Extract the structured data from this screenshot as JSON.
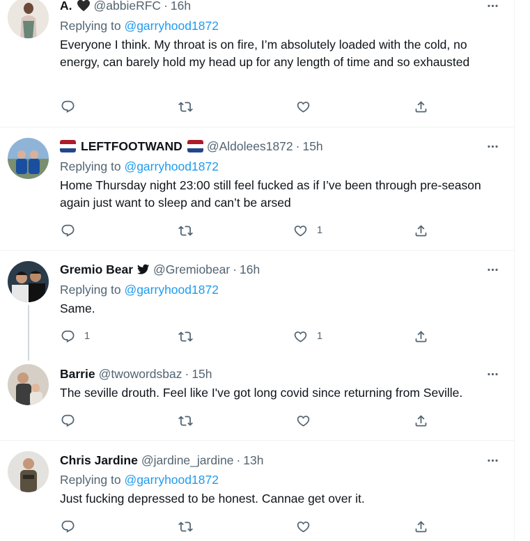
{
  "common": {
    "replying_prefix": "Replying to",
    "dot": "·"
  },
  "tweets": [
    {
      "display_name": "A.",
      "handle": "@abbieRFC",
      "time": "16h",
      "replying_to": "@garryhood1872",
      "text": "Everyone I think. My throat is on fire, I’m absolutely loaded with the cold, no energy, can barely hold my head up for any length of time and so exhausted",
      "reply_count": "",
      "like_count": ""
    },
    {
      "display_name": "LEFTFOOTWAND",
      "handle": "@Aldolees1872",
      "time": "15h",
      "replying_to": "@garryhood1872",
      "text": "Home Thursday night 23:00 still feel fucked as if I’ve been through pre-season again just want to sleep and can’t be arsed",
      "reply_count": "",
      "like_count": "1"
    },
    {
      "display_name": "Gremio Bear",
      "handle": "@Gremiobear",
      "time": "16h",
      "replying_to": "@garryhood1872",
      "text": "Same.",
      "reply_count": "1",
      "like_count": "1"
    },
    {
      "display_name": "Barrie",
      "handle": "@twowordsbaz",
      "time": "15h",
      "text": "The seville drouth. Feel like I've got long covid since returning from Seville.",
      "reply_count": "",
      "like_count": ""
    },
    {
      "display_name": "Chris Jardine",
      "handle": "@jardine_jardine",
      "time": "13h",
      "replying_to": "@garryhood1872",
      "text": "Just fucking depressed to be honest. Cannae get over it.",
      "reply_count": "",
      "like_count": ""
    }
  ],
  "colors": {
    "text": "#0f1419",
    "secondary": "#536471",
    "link": "#1d9bf0",
    "border": "#eff3f4"
  },
  "icons": [
    "reply-icon",
    "retweet-icon",
    "like-icon",
    "share-icon",
    "more-icon",
    "black-heart-icon",
    "netherlands-flag-icon",
    "bird-icon"
  ]
}
